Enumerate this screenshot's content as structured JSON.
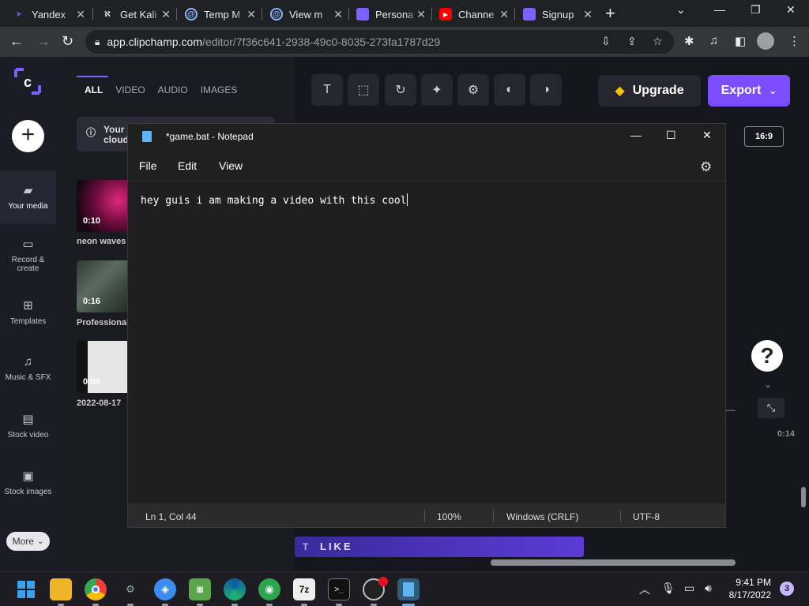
{
  "browser": {
    "tabs": [
      {
        "title": "Yandex",
        "icon": "yandex-icon",
        "color": "#4f6bd8"
      },
      {
        "title": "Get Kali",
        "icon": "kali-icon",
        "color": "#e8eaed"
      },
      {
        "title": "Temp M",
        "icon": "at-sign-icon",
        "color": "#8ab4f8"
      },
      {
        "title": "View m",
        "icon": "at-sign-icon",
        "color": "#8ab4f8"
      },
      {
        "title": "Persona",
        "icon": "clipchamp-icon",
        "color": "#7b61ff"
      },
      {
        "title": "Channe",
        "icon": "youtube-icon",
        "color": "#ff0000"
      },
      {
        "title": "Signup",
        "icon": "clipchamp-icon",
        "color": "#7b61ff"
      }
    ],
    "url_host": "app.clipchamp.com",
    "url_path": "/editor/7f36c641-2938-49c0-8035-273fa1787d29"
  },
  "clipchamp": {
    "nav": [
      {
        "label": "Your media",
        "icon": "folder-icon"
      },
      {
        "label": "Record & create",
        "icon": "camera-icon"
      },
      {
        "label": "Templates",
        "icon": "templates-icon"
      },
      {
        "label": "Music & SFX",
        "icon": "music-note-icon"
      },
      {
        "label": "Stock video",
        "icon": "film-icon"
      },
      {
        "label": "Stock images",
        "icon": "image-icon"
      }
    ],
    "more_label": "More",
    "media_tabs": [
      "ALL",
      "VIDEO",
      "AUDIO",
      "IMAGES"
    ],
    "notice_text": "Your cloud",
    "media": [
      {
        "label": "neon waves",
        "duration": "0:10"
      },
      {
        "label": "Professional",
        "duration": "0:16"
      },
      {
        "label": "2022-08-17",
        "duration": "0:06"
      }
    ],
    "upgrade_label": "Upgrade",
    "export_label": "Export",
    "aspect_ratio": "16:9",
    "help_label": "?",
    "timeline_time": "0:14",
    "caption_label": "LIKE"
  },
  "notepad": {
    "title": "*game.bat - Notepad",
    "menu": [
      "File",
      "Edit",
      "View"
    ],
    "content": "hey guis i am making a video with this cool",
    "status": {
      "position": "Ln 1, Col 44",
      "zoom": "100%",
      "line_ending": "Windows (CRLF)",
      "encoding": "UTF-8"
    }
  },
  "taskbar": {
    "time": "9:41 PM",
    "date": "8/17/2022",
    "notification_count": "3"
  }
}
